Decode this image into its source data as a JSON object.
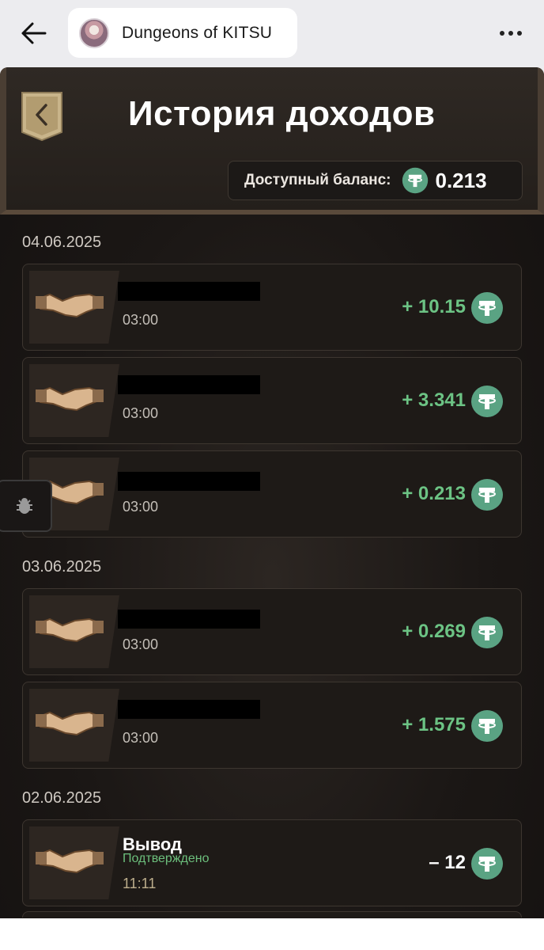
{
  "browser": {
    "app_title": "Dungeons of KITSU"
  },
  "header": {
    "title": "История доходов",
    "balance_label": "Доступный баланс:",
    "balance_value": "0.213"
  },
  "groups": [
    {
      "date": "04.06.2025",
      "items": [
        {
          "time": "03:00",
          "amount": "+ 10.15"
        },
        {
          "time": "03:00",
          "amount": "+ 3.341"
        },
        {
          "time": "03:00",
          "amount": "+ 0.213"
        }
      ]
    },
    {
      "date": "03.06.2025",
      "items": [
        {
          "time": "03:00",
          "amount": "+ 0.269"
        },
        {
          "time": "03:00",
          "amount": "+ 1.575"
        }
      ]
    },
    {
      "date": "02.06.2025",
      "items": [
        {
          "name": "Вывод",
          "status": "Подтверждено",
          "time": "11:11",
          "amount": "– 12"
        }
      ]
    }
  ],
  "colors": {
    "positive": "#6cc384",
    "tether": "#5aa383"
  },
  "icons": [
    "back-arrow-icon",
    "more-icon",
    "back-chevron-icon",
    "tether-icon",
    "handshake-icon",
    "bug-icon"
  ]
}
